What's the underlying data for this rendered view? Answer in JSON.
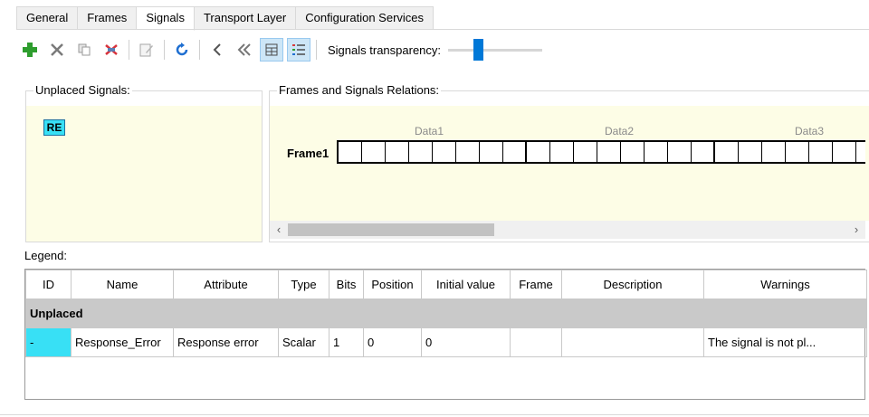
{
  "tabs": [
    {
      "label": "General",
      "active": false
    },
    {
      "label": "Frames",
      "active": false
    },
    {
      "label": "Signals",
      "active": true
    },
    {
      "label": "Transport Layer",
      "active": false
    },
    {
      "label": "Configuration Services",
      "active": false
    }
  ],
  "toolbar": {
    "icons": [
      "add-icon",
      "delete-icon",
      "copy-icon",
      "remove-signal-icon",
      "edit-icon",
      "refresh-icon",
      "back-icon",
      "back-all-icon",
      "grid-view-icon",
      "list-view-icon"
    ],
    "transparency_label": "Signals transparency:",
    "transparency_level": 0.3
  },
  "unplaced": {
    "title": "Unplaced Signals:",
    "badge": "RE"
  },
  "relations": {
    "title": "Frames and Signals Relations:",
    "frame_label": "Frame1",
    "data_labels": [
      "Data1",
      "Data2",
      "Data3"
    ]
  },
  "legend": {
    "label": "Legend:",
    "columns": [
      "ID",
      "Name",
      "Attribute",
      "Type",
      "Bits",
      "Position",
      "Initial value",
      "Frame",
      "Description",
      "Warnings"
    ],
    "group": "Unplaced",
    "rows": [
      {
        "id": "-",
        "name": "Response_Error",
        "attribute": "Response error",
        "type": "Scalar",
        "bits": "1",
        "position": "0",
        "initial": "0",
        "frame": "",
        "description": "",
        "warnings": "The signal is not pl..."
      }
    ]
  },
  "colors": {
    "accent": "#0078d7",
    "signal": "#38e0f5",
    "panel_bg": "#fdfde6"
  }
}
